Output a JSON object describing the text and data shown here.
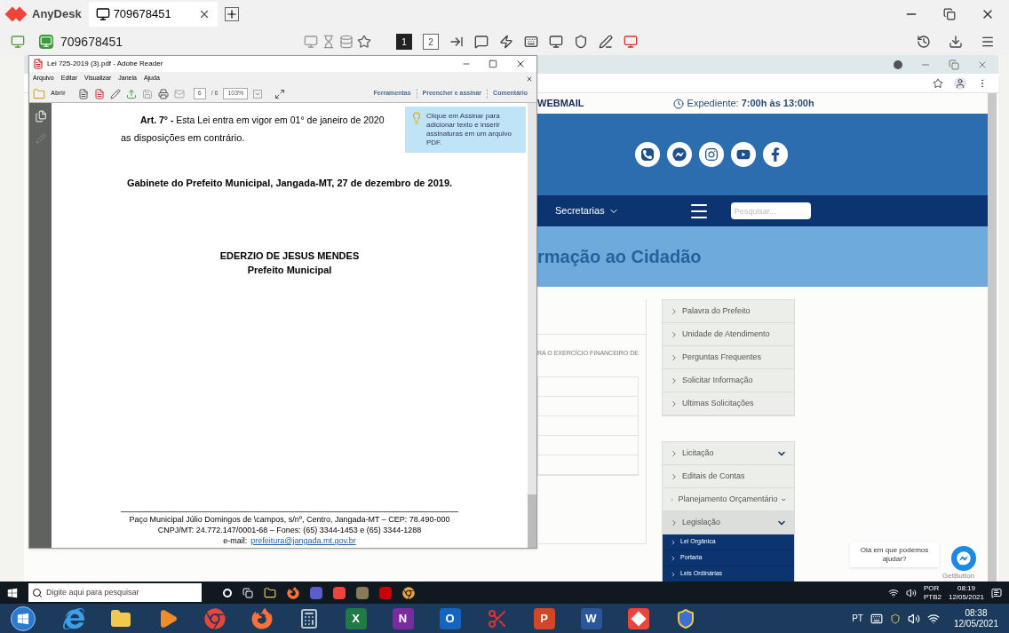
{
  "anydesk": {
    "app_name": "AnyDesk",
    "tab": {
      "label": "709678451",
      "selected": true
    },
    "address": "709678451",
    "monitors": [
      {
        "label": "1",
        "selected": true
      },
      {
        "label": "2",
        "selected": false
      }
    ]
  },
  "pdf_window": {
    "title": "Lei 725-2019 (3).pdf - Adobe Reader",
    "menu": [
      "Arquivo",
      "Editar",
      "Visualizar",
      "Janela",
      "Ajuda"
    ],
    "open_label": "Abrir",
    "page_current": "6",
    "page_total": "/ 6",
    "zoom": "103%",
    "panels": [
      "Ferramentas",
      "Preencher e assinar",
      "Comentário"
    ],
    "tooltip": "Clique em Assinar para adicionar texto e inserir assinaturas em um arquivo PDF.",
    "article": "**Art. 7° -** Esta Lei entra em vigor em 01° de janeiro de 2020",
    "article_cont": "as disposições em contrário.",
    "place_date": "Gabinete do Prefeito Municipal, Jangada-MT, 27 de dezembro de 2019.",
    "signer_name": "EDERZIO DE JESUS MENDES",
    "signer_role": "Prefeito Municipal",
    "footer_lines": [
      "Paço Municipal Júlio Domingos de \\campos, s/nº, Centro, Jangada-MT – CEP: 78.490-000",
      "CNPJ/MT: 24.772.147/0001-68 – Fones: (65) 3344-1453 e (65) 3344-1288"
    ],
    "email_label": "e-mail:",
    "email": "prefeitura@jangada.mt.gov.br"
  },
  "browser": {
    "webmail": "WEBMAIL",
    "hours_label": "Expediente:",
    "hours": "7:00h às 13:00h",
    "nav_item": "Secretarias",
    "search_placeholder": "Pesquisar...",
    "banner_title": "rmação ao Cidadão",
    "content_excerpt": "RA O EXERCÍCIO FINANCEIRO DE",
    "menu_1": [
      "Palavra do Prefeito",
      "Unidade de Atendimento",
      "Perguntas Frequentes",
      "Solicitar Informação",
      "Ultimas Solicitações"
    ],
    "menu_2": [
      {
        "label": "Licitação",
        "expandable": true,
        "expanded": false
      },
      {
        "label": "Editais de Contas",
        "expandable": false,
        "expanded": false
      },
      {
        "label": "Planejamento Orçamentário",
        "expandable": true,
        "expanded": false
      },
      {
        "label": "Legislação",
        "expandable": true,
        "expanded": true
      }
    ],
    "submenu": [
      "Lei Orgânica",
      "Portaria",
      "Leis Ordinárias"
    ],
    "chat_prompt": "Olá em que podemos ajudar?",
    "chat_brand": "GetButton"
  },
  "remote_taskbar": {
    "search_placeholder": "Digite aqui para pesquisar",
    "lang": "POR",
    "layout": "PTB2",
    "time": "08:19",
    "date": "12/05/2021"
  },
  "local_taskbar": {
    "apps": [
      {
        "kind": "ie"
      },
      {
        "kind": "explorer"
      },
      {
        "kind": "media"
      },
      {
        "kind": "chrome"
      },
      {
        "kind": "firefox"
      },
      {
        "kind": "calculator"
      },
      {
        "kind": "letter",
        "letter": "X",
        "color": "#1f7a45"
      },
      {
        "kind": "letter",
        "letter": "N",
        "color": "#7a2c9e"
      },
      {
        "kind": "letter",
        "letter": "O",
        "color": "#1565c0"
      },
      {
        "kind": "snipping"
      },
      {
        "kind": "letter",
        "letter": "P",
        "color": "#d24726"
      },
      {
        "kind": "letter",
        "letter": "W",
        "color": "#2b579a"
      },
      {
        "kind": "anydesk"
      },
      {
        "kind": "shield"
      }
    ],
    "lang": "PT",
    "time": "08:38",
    "date": "12/05/2021"
  }
}
